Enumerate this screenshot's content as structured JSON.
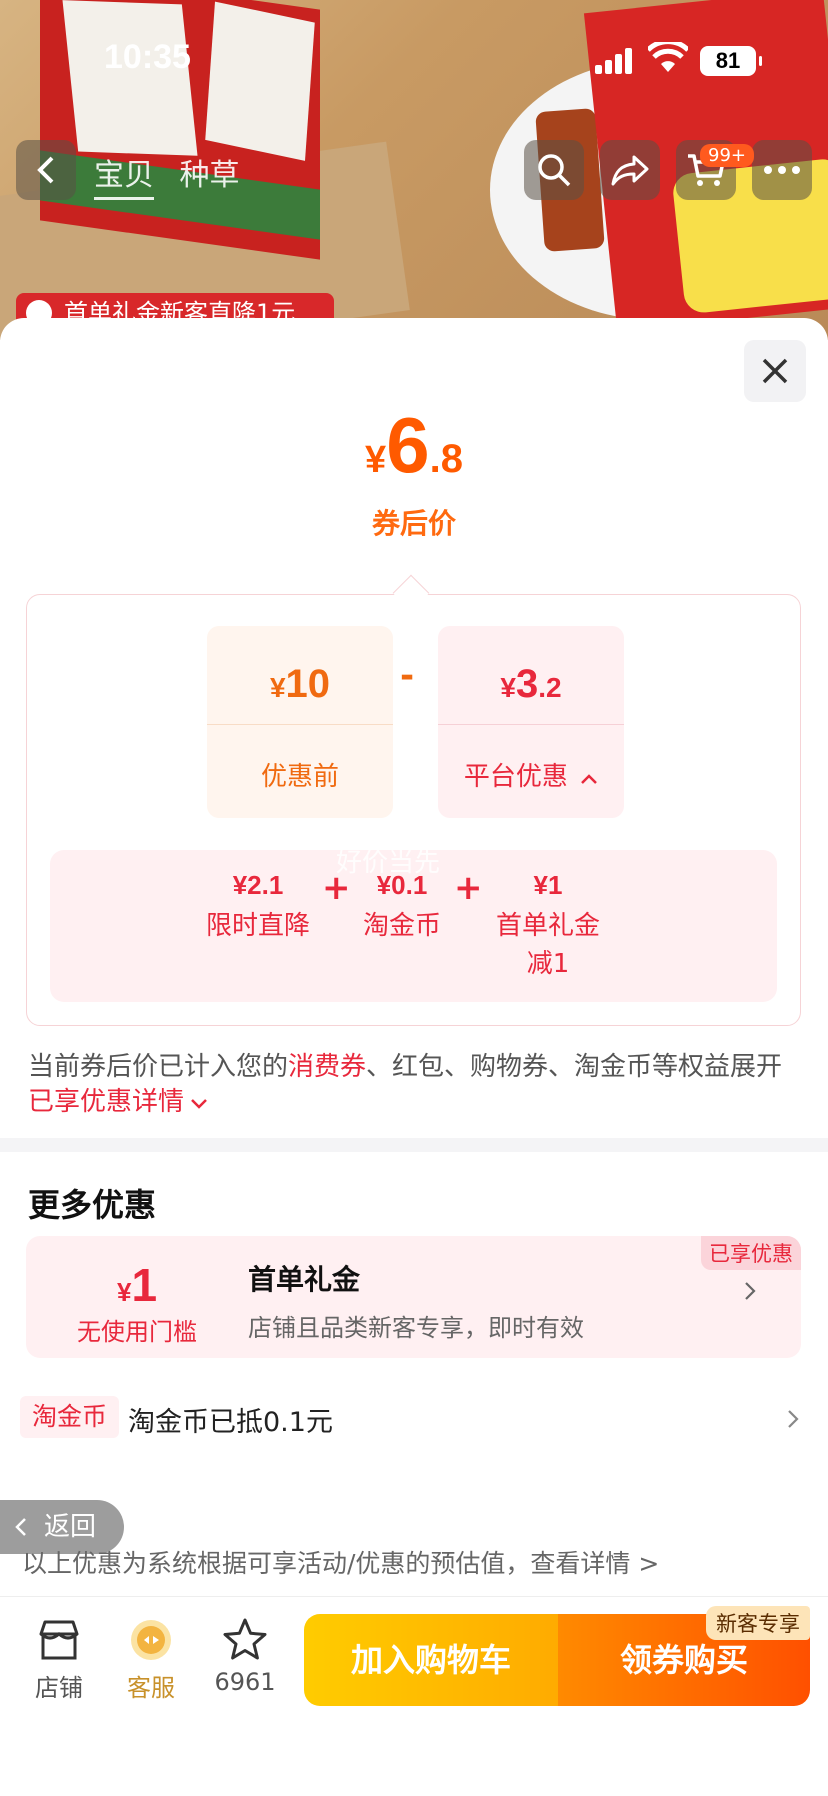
{
  "status_bar": {
    "time": "10:35",
    "battery": "81"
  },
  "nav": {
    "tabs": [
      "宝贝",
      "种草"
    ],
    "cart_badge": "99+"
  },
  "promo_chip": "首单礼金新客直降1元",
  "price": {
    "currency": "¥",
    "integer": "6",
    "decimal": ".8",
    "caption": "券后价"
  },
  "calc": {
    "before": {
      "currency": "¥",
      "value": "10",
      "label": "优惠前"
    },
    "operator": "-",
    "platform": {
      "currency": "¥",
      "value": "3",
      "decimal": ".2",
      "label": "平台优惠"
    },
    "watermark": "好价当先",
    "breakdown": [
      {
        "amount": "¥2.1",
        "name": "限时直降"
      },
      {
        "amount": "¥0.1",
        "name": "淘金币"
      },
      {
        "amount": "¥1",
        "name": "首单礼金\n减1"
      }
    ],
    "plus": "+"
  },
  "notice": {
    "part1": "当前券后价已计入您的",
    "highlight1": "消费券",
    "part2": "、红包、购物券、淘金币等权益展开",
    "highlight2": "已享优惠详情"
  },
  "more_offers": {
    "title": "更多优惠",
    "coupon": {
      "currency": "¥",
      "value": "1",
      "condition": "无使用门槛",
      "title": "首单礼金",
      "desc": "店铺且品类新客专享，即时有效",
      "badge": "已享优惠"
    },
    "coin": {
      "tag": "淘金币",
      "text": "淘金币已抵0.1元"
    }
  },
  "back_label": "返回",
  "disclaimer": "以上优惠为系统根据可享活动/优惠的预估值，查看详情 >",
  "bottom_bar": {
    "shop_label": "店铺",
    "service_label": "客服",
    "fav_count": "6961",
    "cart_button": "加入购物车",
    "buy_button": "领券购买",
    "new_tag": "新客专享"
  },
  "colors": {
    "accent_orange": "#ff5a00",
    "accent_red": "#e8283c"
  }
}
